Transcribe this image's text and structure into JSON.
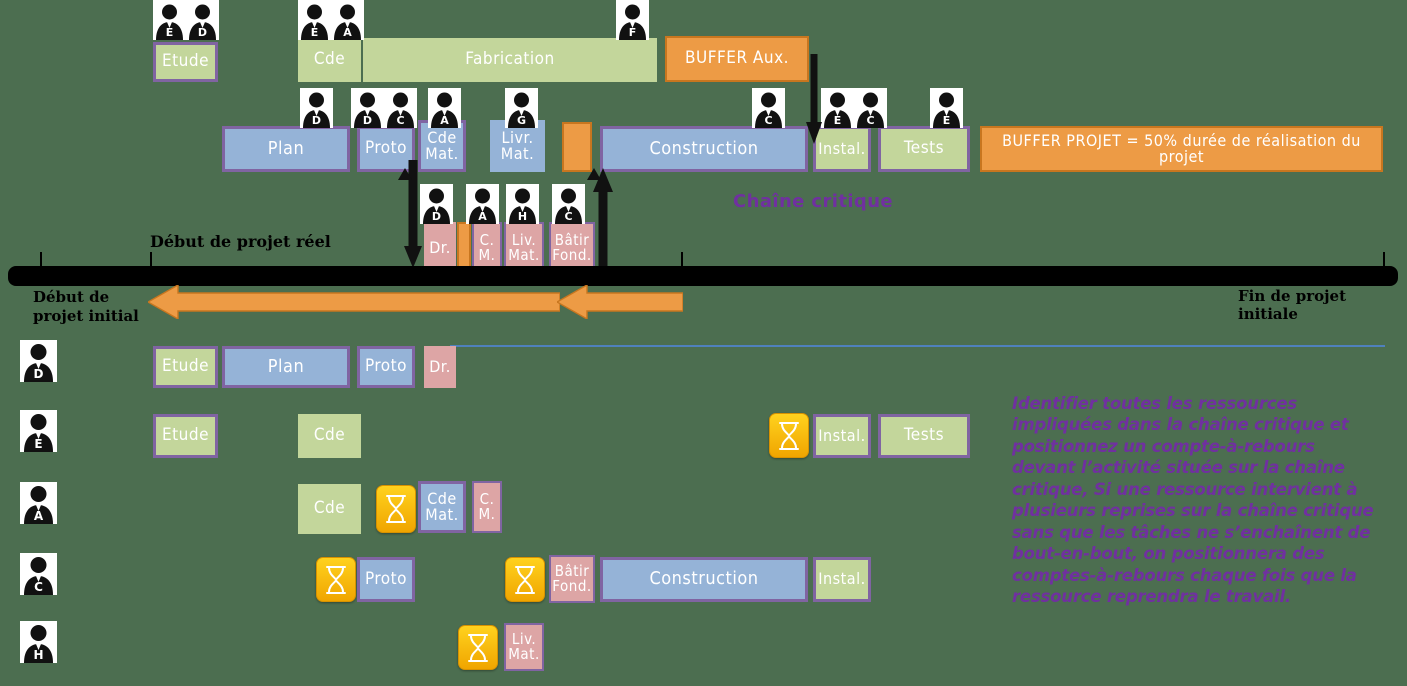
{
  "meta": {
    "title": "Chaîne critique - planning projet avec buffers et comptes-à-rebours",
    "colors": {
      "green": "#c3d69b",
      "blue": "#95b3d7",
      "orange": "#ed9b45",
      "pink": "#dda5a5",
      "purple_border": "#8064a2",
      "purple_text": "#7030a0",
      "timeline_black": "#000000",
      "rule_blue": "#4f81bd",
      "background": "#4c6e50",
      "hourglass_yellow": "#ffd21e"
    }
  },
  "top_chain": {
    "tasks": [
      {
        "label": "Etude",
        "resources": [
          "E",
          "D"
        ]
      },
      {
        "label": "Cde",
        "resources": [
          "E",
          "A"
        ]
      },
      {
        "label": "Fabrication",
        "resources": [
          "F"
        ]
      },
      {
        "label": "BUFFER  Aux.",
        "resources": []
      }
    ]
  },
  "critical_chain": {
    "label": "Chaîne critique",
    "tasks": [
      {
        "label": "Plan",
        "resources": [
          "D"
        ]
      },
      {
        "label": "Proto",
        "resources": [
          "D",
          "C"
        ]
      },
      {
        "label": "Cde\nMat.",
        "resources": [
          "A"
        ]
      },
      {
        "label": "Livr.\nMat.",
        "resources": [
          "G"
        ]
      },
      {
        "label": "",
        "resources": []
      },
      {
        "label": "Construction",
        "resources": [
          "C"
        ]
      },
      {
        "label": "Instal.",
        "resources": [
          "E",
          "C"
        ]
      },
      {
        "label": "Tests",
        "resources": [
          "E"
        ]
      }
    ],
    "project_buffer": "BUFFER  PROJET = 50% durée de réalisation du projet"
  },
  "feeding_chain": {
    "tasks": [
      {
        "label": "Dr.",
        "resources": [
          "D"
        ]
      },
      {
        "label": "",
        "resources": []
      },
      {
        "label": "C.\nM.",
        "resources": [
          "A"
        ]
      },
      {
        "label": "Liv.\nMat.",
        "resources": [
          "H"
        ]
      },
      {
        "label": "Bâtir\nFond.",
        "resources": [
          "C"
        ]
      }
    ]
  },
  "timeline": {
    "start_real_label": "Début de projet réel",
    "start_initial_label": "Début de\nprojet initial",
    "end_initial_label": "Fin de projet initiale"
  },
  "resource_rows": [
    {
      "resource": "D",
      "tasks": [
        {
          "label": "Etude",
          "type": "green",
          "countdown": false
        },
        {
          "label": "Plan",
          "type": "blue",
          "countdown": false
        },
        {
          "label": "Proto",
          "type": "blue",
          "countdown": false
        },
        {
          "label": "Dr.",
          "type": "pink",
          "countdown": false
        }
      ]
    },
    {
      "resource": "E",
      "tasks": [
        {
          "label": "Etude",
          "type": "green",
          "countdown": false
        },
        {
          "label": "Cde",
          "type": "green",
          "countdown": false
        },
        {
          "label": "Instal.",
          "type": "green",
          "countdown": true
        },
        {
          "label": "Tests",
          "type": "green",
          "countdown": false
        }
      ]
    },
    {
      "resource": "A",
      "tasks": [
        {
          "label": "Cde",
          "type": "green",
          "countdown": false
        },
        {
          "label": "Cde\nMat.",
          "type": "blue",
          "countdown": true
        },
        {
          "label": "C.\nM.",
          "type": "pink",
          "countdown": false
        }
      ]
    },
    {
      "resource": "C",
      "tasks": [
        {
          "label": "Proto",
          "type": "blue",
          "countdown": true
        },
        {
          "label": "Bâtir\nFond.",
          "type": "pink",
          "countdown": true
        },
        {
          "label": "Construction",
          "type": "blue",
          "countdown": false
        },
        {
          "label": "Instal.",
          "type": "green",
          "countdown": false
        }
      ]
    },
    {
      "resource": "H",
      "tasks": [
        {
          "label": "Liv.\nMat.",
          "type": "pink",
          "countdown": true
        }
      ]
    }
  ],
  "note": {
    "lines": [
      "Identifier toutes les ressources",
      "impliquées dans la chaîne critique et",
      "positionnez un compte-à-rebours",
      "devant l’activité située sur la chaîne",
      "critique, Si une ressource intervient à",
      "plusieurs reprises sur la chaîne critique",
      "sans que les tâches ne s’enchaînent de",
      "bout-en-bout, on positionnera des",
      "comptes-à-rebours chaque fois que la",
      "ressource reprendra le travail."
    ]
  },
  "icons": {
    "person": "person-icon",
    "hourglass": "hourglass-icon",
    "arrow_left": "arrow-left-icon"
  }
}
